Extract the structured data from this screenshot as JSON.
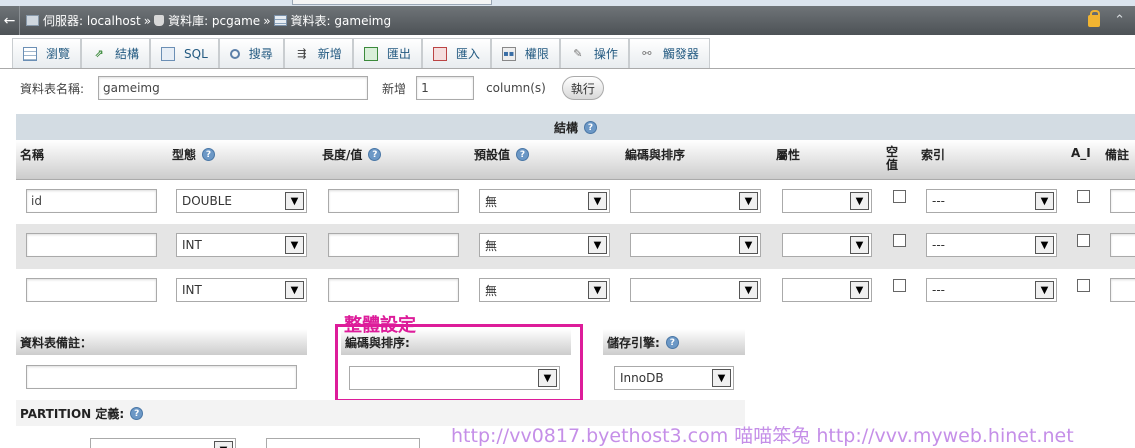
{
  "breadcrumb": {
    "back": "←",
    "server": "伺服器: localhost",
    "database": "資料庫: pcgame",
    "table": "資料表: gameimg",
    "sep": "»"
  },
  "tabs": [
    {
      "label": "瀏覽",
      "icon": "browse-icon"
    },
    {
      "label": "結構",
      "icon": "structure-icon"
    },
    {
      "label": "SQL",
      "icon": "sql-icon"
    },
    {
      "label": "搜尋",
      "icon": "search-icon"
    },
    {
      "label": "新增",
      "icon": "insert-icon"
    },
    {
      "label": "匯出",
      "icon": "export-icon"
    },
    {
      "label": "匯入",
      "icon": "import-icon"
    },
    {
      "label": "權限",
      "icon": "privileges-icon"
    },
    {
      "label": "操作",
      "icon": "operations-icon"
    },
    {
      "label": "觸發器",
      "icon": "triggers-icon"
    }
  ],
  "table_name": {
    "label": "資料表名稱:",
    "value": "gameimg",
    "add_label": "新增",
    "add_count": "1",
    "columns_label": "column(s)",
    "execute": "執行"
  },
  "structure": {
    "title": "結構",
    "headers": {
      "name": "名稱",
      "type": "型態",
      "length": "長度/值",
      "default": "預設值",
      "collation": "編碼與排序",
      "attributes": "屬性",
      "null": "空值",
      "index": "索引",
      "ai": "A_I",
      "comments": "備註"
    },
    "rows": [
      {
        "name": "id",
        "type": "DOUBLE",
        "length": "",
        "default": "無",
        "collation": "",
        "attribute": "",
        "index": "---"
      },
      {
        "name": "",
        "type": "INT",
        "length": "",
        "default": "無",
        "collation": "",
        "attribute": "",
        "index": "---"
      },
      {
        "name": "",
        "type": "INT",
        "length": "",
        "default": "無",
        "collation": "",
        "attribute": "",
        "index": "---"
      }
    ]
  },
  "bottom": {
    "table_comment_label": "資料表備註：",
    "collation_label": "編碼與排序:",
    "engine_label": "儲存引擎:",
    "engine_value": "InnoDB",
    "partition_label": "PARTITION 定義:",
    "annotation": "整體設定"
  },
  "watermark": "http://vv0817.byethost3.com 喵喵笨兔 http://vvv.myweb.hinet.net",
  "colors": {
    "accent": "#dd1c9a",
    "header_bar": "#55595d",
    "section": "#d3dce3"
  }
}
